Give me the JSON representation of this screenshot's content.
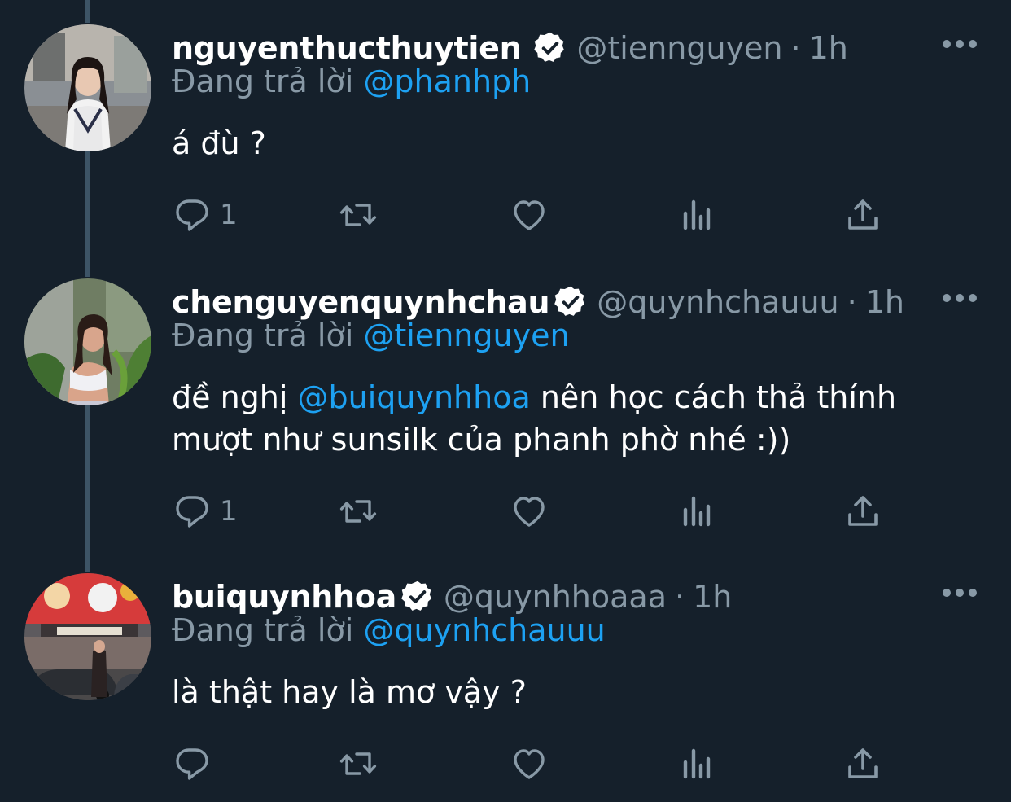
{
  "reply_prefix": "Đang trả lời",
  "colors": {
    "background": "#15202b",
    "text_secondary": "#8899a6",
    "link": "#1da1f2",
    "thread_line": "#3d5466"
  },
  "tweets": [
    {
      "name": "nguyenthucthuytien",
      "verified": true,
      "handle": "@tiennguyen",
      "separator": "·",
      "time": "1h",
      "reply_to": "@phanhph",
      "text_lines": [
        "á đù ?"
      ],
      "mention": "",
      "text_after_mention": "",
      "reply_count": "1",
      "icons": [
        "reply-icon",
        "retweet-icon",
        "like-icon",
        "analytics-icon",
        "share-icon",
        "more-icon"
      ]
    },
    {
      "name": "chenguyenquynhchau",
      "verified": true,
      "handle": "@quynhchauuu",
      "separator": "·",
      "time": "1h",
      "reply_to": "@tiennguyen",
      "text_prefix": "đề nghị ",
      "mention": "@buiquynhhoa",
      "text_after_mention": " nên học cách thả thính",
      "text_line2": "mượt như sunsilk của phanh phờ nhé :))",
      "reply_count": "1",
      "icons": [
        "reply-icon",
        "retweet-icon",
        "like-icon",
        "analytics-icon",
        "share-icon",
        "more-icon"
      ]
    },
    {
      "name": "buiquynhhoa",
      "verified": true,
      "handle": "@quynhhoaaa",
      "separator": "·",
      "time": "1h",
      "reply_to": "@quynhchauuu",
      "text_lines": [
        "là thật hay là mơ vậy ?"
      ],
      "reply_count": "",
      "icons": [
        "reply-icon",
        "retweet-icon",
        "like-icon",
        "analytics-icon",
        "share-icon",
        "more-icon"
      ]
    }
  ]
}
